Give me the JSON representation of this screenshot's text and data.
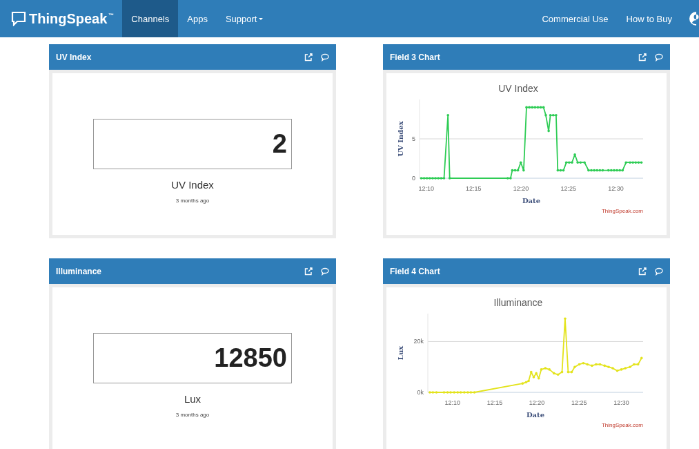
{
  "navbar": {
    "brand": "ThingSpeak",
    "trademark": "™",
    "links": [
      {
        "label": "Channels",
        "selected": true,
        "dropdown": false
      },
      {
        "label": "Apps",
        "selected": false,
        "dropdown": false
      },
      {
        "label": "Support",
        "selected": false,
        "dropdown": true
      }
    ],
    "right_links": [
      "Commercial Use",
      "How to Buy"
    ]
  },
  "widgets": [
    {
      "kind": "numeric",
      "title": "UV Index",
      "value": "2",
      "label": "UV Index",
      "time": "3 months ago"
    },
    {
      "kind": "chart",
      "title": "Field 3 Chart",
      "credit": "ThingSpeak.com",
      "chart_data": {
        "type": "line",
        "title": "UV Index",
        "xlabel": "Date",
        "ylabel": "UV Index",
        "xlim": [
          12.155,
          12.548
        ],
        "ylim": [
          0,
          10
        ],
        "xticks": [
          {
            "value": 12.1667,
            "label": "12:10"
          },
          {
            "value": 12.25,
            "label": "12:15"
          },
          {
            "value": 12.3333,
            "label": "12:20"
          },
          {
            "value": 12.4167,
            "label": "12:25"
          },
          {
            "value": 12.5,
            "label": "12:30"
          }
        ],
        "yticks": [
          0,
          5
        ],
        "x": [
          12.158,
          12.163,
          12.168,
          12.173,
          12.178,
          12.183,
          12.188,
          12.193,
          12.198,
          12.205,
          12.208,
          12.31,
          12.315,
          12.318,
          12.323,
          12.328,
          12.333,
          12.338,
          12.343,
          12.348,
          12.353,
          12.358,
          12.363,
          12.368,
          12.373,
          12.377,
          12.382,
          12.385,
          12.39,
          12.395,
          12.398,
          12.403,
          12.408,
          12.413,
          12.418,
          12.423,
          12.428,
          12.433,
          12.438,
          12.445,
          12.452,
          12.457,
          12.462,
          12.467,
          12.472,
          12.477,
          12.487,
          12.492,
          12.497,
          12.502,
          12.507,
          12.512,
          12.518,
          12.525,
          12.53,
          12.535,
          12.54,
          12.545
        ],
        "series": [
          {
            "color": "#2ecc55",
            "values": [
              0,
              0,
              0,
              0,
              0,
              0,
              0,
              0,
              0,
              8,
              0,
              0,
              0,
              1,
              1,
              1,
              2,
              1,
              9,
              9,
              9,
              9,
              9,
              9,
              9,
              8,
              6,
              8,
              8,
              8,
              1,
              1,
              1,
              2,
              2,
              2,
              3,
              2,
              2,
              2,
              1,
              1,
              1,
              1,
              1,
              1,
              1,
              1,
              1,
              1,
              1,
              1,
              2,
              2,
              2,
              2,
              2,
              2
            ]
          }
        ]
      }
    },
    {
      "kind": "numeric",
      "title": "Illuminance",
      "value": "12850",
      "label": "Lux",
      "time": "3 months ago"
    },
    {
      "kind": "chart",
      "title": "Field 4 Chart",
      "credit": "ThingSpeak.com",
      "chart_data": {
        "type": "line",
        "title": "Illuminance",
        "xlabel": "Date",
        "ylabel": "Lux",
        "xlim": [
          12.118,
          12.543
        ],
        "ylim": [
          0,
          31000
        ],
        "xticks": [
          {
            "value": 12.1667,
            "label": "12:10"
          },
          {
            "value": 12.25,
            "label": "12:15"
          },
          {
            "value": 12.3333,
            "label": "12:20"
          },
          {
            "value": 12.4167,
            "label": "12:25"
          },
          {
            "value": 12.5,
            "label": "12:30"
          }
        ],
        "yticks": [
          {
            "value": 0,
            "label": "0k"
          },
          {
            "value": 20000,
            "label": "20k"
          }
        ],
        "x": [
          12.122,
          12.128,
          12.135,
          12.15,
          12.157,
          12.163,
          12.17,
          12.177,
          12.183,
          12.19,
          12.197,
          12.203,
          12.21,
          12.305,
          12.312,
          12.317,
          12.322,
          12.327,
          12.332,
          12.337,
          12.342,
          12.35,
          12.358,
          12.367,
          12.375,
          12.383,
          12.389,
          12.395,
          12.402,
          12.408,
          12.417,
          12.425,
          12.433,
          12.442,
          12.45,
          12.458,
          12.467,
          12.475,
          12.483,
          12.492,
          12.5,
          12.508,
          12.517,
          12.525,
          12.533,
          12.54
        ],
        "series": [
          {
            "color": "#e3e31c",
            "values": [
              0,
              0,
              0,
              0,
              0,
              0,
              0,
              0,
              0,
              0,
              0,
              0,
              0,
              3500,
              4000,
              4500,
              8000,
              6000,
              7500,
              5500,
              9000,
              9500,
              9000,
              7500,
              7000,
              8000,
              29000,
              8000,
              8000,
              10000,
              11000,
              11500,
              11000,
              10500,
              11000,
              11000,
              10500,
              10000,
              9500,
              8500,
              9000,
              9500,
              10000,
              11000,
              11000,
              13500
            ]
          }
        ]
      }
    }
  ]
}
